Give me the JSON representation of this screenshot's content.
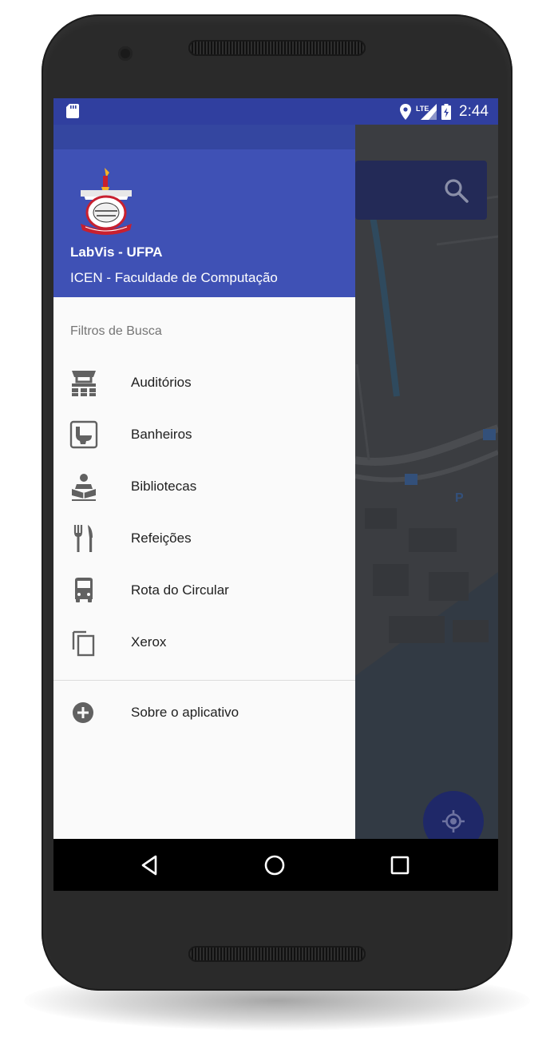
{
  "status_bar": {
    "time": "2:44",
    "icons": [
      "sd-card-icon",
      "location-icon",
      "lte-signal-icon",
      "battery-charging-icon"
    ]
  },
  "drawer": {
    "header": {
      "title": "LabVis - UFPA",
      "subtitle": "ICEN - Faculdade de Computação"
    },
    "section_label": "Filtros de Busca",
    "items": [
      {
        "label": "Auditórios",
        "icon": "auditorium-icon"
      },
      {
        "label": "Banheiros",
        "icon": "toilet-icon"
      },
      {
        "label": "Bibliotecas",
        "icon": "library-reader-icon"
      },
      {
        "label": "Refeições",
        "icon": "fork-knife-icon"
      },
      {
        "label": "Rota do Circular",
        "icon": "bus-icon"
      },
      {
        "label": "Xerox",
        "icon": "copy-icon"
      }
    ],
    "about": {
      "label": "Sobre o aplicativo",
      "icon": "plus-circle-icon"
    }
  },
  "map": {
    "search_icon": "search-icon",
    "fab_icon": "my-location-icon"
  },
  "nav_bar": {
    "buttons": [
      "back-icon",
      "home-icon",
      "recents-icon"
    ]
  },
  "colors": {
    "status_bar": "#303f9f",
    "header": "#3f51b5",
    "drawer_bg": "#fafafa",
    "phone_body": "#2a2a2a"
  }
}
